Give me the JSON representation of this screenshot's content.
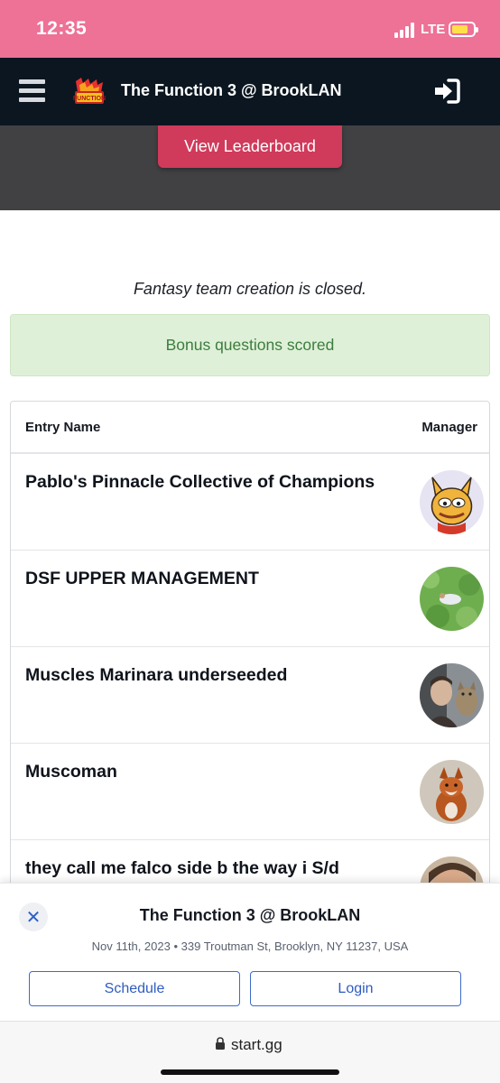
{
  "status_bar": {
    "time": "12:35",
    "network": "LTE"
  },
  "header": {
    "title": "The Function 3 @ BrookLAN",
    "logo_alt": "Function logo"
  },
  "hero": {
    "leaderboard_button": "View Leaderboard"
  },
  "notice": "Fantasy team creation is closed.",
  "alert": "Bonus questions scored",
  "table": {
    "columns": {
      "entry": "Entry Name",
      "manager": "Manager"
    },
    "rows": [
      {
        "entry_name": "Pablo's Pinnacle Collective of Champions"
      },
      {
        "entry_name": "DSF UPPER MANAGEMENT"
      },
      {
        "entry_name": "Muscles Marinara underseeded"
      },
      {
        "entry_name": "Muscoman"
      },
      {
        "entry_name": "they call me falco side b the way i S/d"
      }
    ]
  },
  "sheet": {
    "close": "✕",
    "title": "The Function 3 @ BrookLAN",
    "subtitle": "Nov 11th, 2023 • 339 Troutman St, Brooklyn, NY 11237, USA",
    "schedule_button": "Schedule",
    "login_button": "Login"
  },
  "browser": {
    "url": "start.gg"
  },
  "colors": {
    "status_bar": "#ee7196",
    "app_bar": "#0b1620",
    "hero": "#414143",
    "accent_button": "#d03a5b",
    "alert_bg": "#dff0d8",
    "alert_text": "#3c7d3e",
    "link_blue": "#2f5cc0"
  }
}
